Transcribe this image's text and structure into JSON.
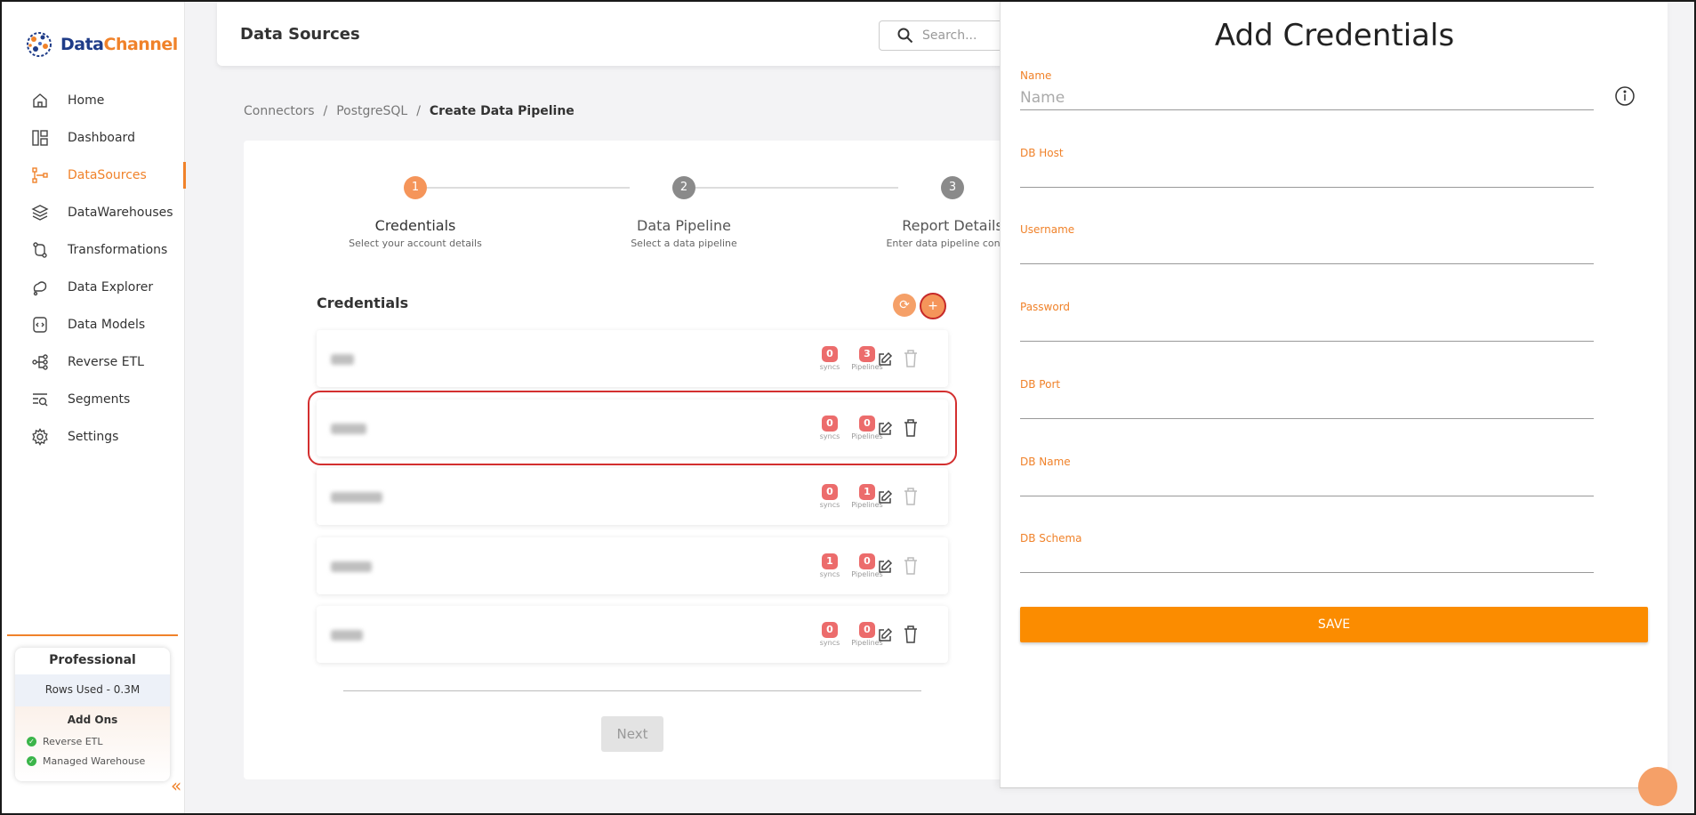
{
  "brand": {
    "name_part1": "Data",
    "name_part2": "Channel"
  },
  "sidebar": {
    "items": [
      {
        "label": "Home",
        "icon": "home-icon"
      },
      {
        "label": "Dashboard",
        "icon": "dashboard-icon"
      },
      {
        "label": "DataSources",
        "icon": "datasources-icon",
        "active": true
      },
      {
        "label": "DataWarehouses",
        "icon": "layers-icon"
      },
      {
        "label": "Transformations",
        "icon": "transform-icon"
      },
      {
        "label": "Data Explorer",
        "icon": "explorer-icon"
      },
      {
        "label": "Data Models",
        "icon": "models-icon"
      },
      {
        "label": "Reverse ETL",
        "icon": "share-icon"
      },
      {
        "label": "Segments",
        "icon": "segments-icon"
      },
      {
        "label": "Settings",
        "icon": "gear-icon"
      }
    ]
  },
  "plan": {
    "name": "Professional",
    "rows_used": "Rows Used - 0.3M",
    "addons_title": "Add Ons",
    "addons": [
      "Reverse ETL",
      "Managed Warehouse"
    ]
  },
  "header": {
    "title": "Data Sources",
    "search_placeholder": "Search..."
  },
  "breadcrumb": [
    "Connectors",
    "PostgreSQL",
    "Create Data Pipeline"
  ],
  "steps": [
    {
      "num": "1",
      "name": "Credentials",
      "desc": "Select your account details",
      "active": true
    },
    {
      "num": "2",
      "name": "Data Pipeline",
      "desc": "Select a data pipeline"
    },
    {
      "num": "3",
      "name": "Report Details",
      "desc": "Enter data pipeline configu"
    }
  ],
  "credentials": {
    "title": "Credentials",
    "add_symbol": "+",
    "refresh_symbol": "⟳",
    "syncs_label": "syncs",
    "pipelines_label": "Pipelines",
    "rows": [
      {
        "syncs": "0",
        "pipelines": "3"
      },
      {
        "syncs": "0",
        "pipelines": "0",
        "highlighted": true
      },
      {
        "syncs": "0",
        "pipelines": "1"
      },
      {
        "syncs": "1",
        "pipelines": "0"
      },
      {
        "syncs": "0",
        "pipelines": "0"
      }
    ]
  },
  "next_label": "Next",
  "panel": {
    "title": "Add Credentials",
    "save_label": "SAVE",
    "fields": [
      {
        "label": "Name",
        "placeholder": "Name",
        "value": ""
      },
      {
        "label": "DB Host",
        "placeholder": "",
        "value": ""
      },
      {
        "label": "Username",
        "placeholder": "",
        "value": ""
      },
      {
        "label": "Password",
        "placeholder": "",
        "value": ""
      },
      {
        "label": "DB Port",
        "placeholder": "",
        "value": ""
      },
      {
        "label": "DB Name",
        "placeholder": "",
        "value": ""
      },
      {
        "label": "DB Schema",
        "placeholder": "",
        "value": ""
      }
    ]
  },
  "colors": {
    "accent": "#f0822a",
    "badge": "#ec6c6c",
    "save": "#fb8c00",
    "step_inactive": "#8a8a8a"
  }
}
